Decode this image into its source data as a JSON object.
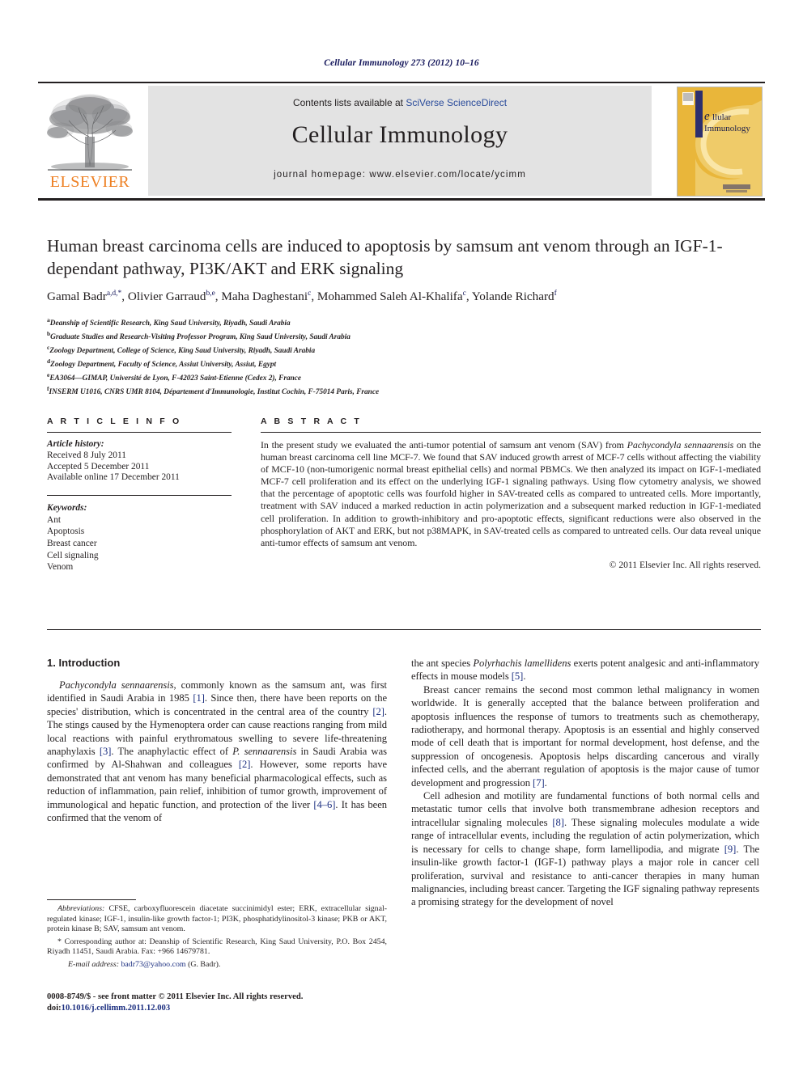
{
  "running_head": "Cellular Immunology 273 (2012) 10–16",
  "masthead": {
    "contents_prefix": "Contents lists available at ",
    "sciencedirect": "SciVerse ScienceDirect",
    "journal_title": "Cellular Immunology",
    "homepage": "journal homepage: www.elsevier.com/locate/ycimm",
    "publisher_wordmark": "ELSEVIER",
    "cover_title_line1": "ellular",
    "cover_title_line2": "Immunology"
  },
  "article": {
    "title": "Human breast carcinoma cells are induced to apoptosis by samsum ant venom through an IGF-1-dependant pathway, PI3K/AKT and ERK signaling",
    "authors": [
      {
        "name": "Gamal Badr",
        "sup": "a,d,*"
      },
      {
        "name": "Olivier Garraud",
        "sup": "b,e"
      },
      {
        "name": "Maha Daghestani",
        "sup": "c"
      },
      {
        "name": "Mohammed Saleh Al-Khalifa",
        "sup": "c"
      },
      {
        "name": "Yolande Richard",
        "sup": "f"
      }
    ],
    "affiliations": [
      {
        "label": "a",
        "text": "Deanship of Scientific Research, King Saud University, Riyadh, Saudi Arabia"
      },
      {
        "label": "b",
        "text": "Graduate Studies and Research-Visiting Professor Program, King Saud University, Saudi Arabia"
      },
      {
        "label": "c",
        "text": "Zoology Department, College of Science, King Saud University, Riyadh, Saudi Arabia"
      },
      {
        "label": "d",
        "text": "Zoology Department, Faculty of Science, Assiut University, Assiut, Egypt"
      },
      {
        "label": "e",
        "text": "EA3064—GIMAP, Université de Lyon, F-42023 Saint-Etienne (Cedex 2), France"
      },
      {
        "label": "f",
        "text": "INSERM U1016, CNRS UMR 8104, Département d'Immunologie, Institut Cochin, F-75014 Paris, France"
      }
    ]
  },
  "article_info": {
    "heading": "A R T I C L E   I N F O",
    "history_label": "Article history:",
    "history": [
      "Received 8 July 2011",
      "Accepted 5 December 2011",
      "Available online 17 December 2011"
    ],
    "keywords_label": "Keywords:",
    "keywords": [
      "Ant",
      "Apoptosis",
      "Breast cancer",
      "Cell signaling",
      "Venom"
    ]
  },
  "abstract": {
    "heading": "A B S T R A C T",
    "part1": "In the present study we evaluated the anti-tumor potential of samsum ant venom (SAV) from ",
    "italic1": "Pachycondyla sennaarensis",
    "part2": " on the human breast carcinoma cell line MCF-7. We found that SAV induced growth arrest of MCF-7 cells without affecting the viability of MCF-10 (non-tumorigenic normal breast epithelial cells) and normal PBMCs. We then analyzed its impact on IGF-1-mediated MCF-7 cell proliferation and its effect on the underlying IGF-1 signaling pathways. Using flow cytometry analysis, we showed that the percentage of apoptotic cells was fourfold higher in SAV-treated cells as compared to untreated cells. More importantly, treatment with SAV induced a marked reduction in actin polymerization and a subsequent marked reduction in IGF-1-mediated cell proliferation. In addition to growth-inhibitory and pro-apoptotic effects, significant reductions were also observed in the phosphorylation of AKT and ERK, but not p38MAPK, in SAV-treated cells as compared to untreated cells. Our data reveal unique anti-tumor effects of samsum ant venom.",
    "copyright": "© 2011 Elsevier Inc. All rights reserved."
  },
  "body": {
    "section_heading": "1. Introduction",
    "left_para1_a": "",
    "left_para1_italic": "Pachycondyla sennaarensis",
    "left_para1_b": ", commonly known as the samsum ant, was first identified in Saudi Arabia in 1985 ",
    "left_cite1": "[1]",
    "left_para1_c": ". Since then, there have been reports on the species' distribution, which is concentrated in the central area of the country ",
    "left_cite2": "[2]",
    "left_para1_d": ". The stings caused by the Hymenoptera order can cause reactions ranging from mild local reactions with painful erythromatous swelling to severe life-threatening anaphylaxis ",
    "left_cite3": "[3]",
    "left_para1_e": ". The anaphylactic effect of ",
    "left_para1_italic2": "P. sennaarensis",
    "left_para1_f": " in Saudi Arabia was confirmed by Al-Shahwan and colleagues ",
    "left_cite4": "[2]",
    "left_para1_g": ". However, some reports have demonstrated that ant venom has many beneficial pharmacological effects, such as reduction of inflammation, pain relief, inhibition of tumor growth, improvement of immunological and hepatic function, and protection of the liver ",
    "left_cite5": "[4–6]",
    "left_para1_h": ". It has been confirmed that the venom of",
    "right_para1_a": "the ant species ",
    "right_para1_italic": "Polyrhachis lamellidens",
    "right_para1_b": " exerts potent analgesic and anti-inflammatory effects in mouse models ",
    "right_cite1": "[5]",
    "right_para1_c": ".",
    "right_para2_a": "Breast cancer remains the second most common lethal malignancy in women worldwide. It is generally accepted that the balance between proliferation and apoptosis influences the response of tumors to treatments such as chemotherapy, radiotherapy, and hormonal therapy. Apoptosis is an essential and highly conserved mode of cell death that is important for normal development, host defense, and the suppression of oncogenesis. Apoptosis helps discarding cancerous and virally infected cells, and the aberrant regulation of apoptosis is the major cause of tumor development and progression ",
    "right_cite2": "[7]",
    "right_para2_b": ".",
    "right_para3_a": "Cell adhesion and motility are fundamental functions of both normal cells and metastatic tumor cells that involve both transmembrane adhesion receptors and intracellular signaling molecules ",
    "right_cite3": "[8]",
    "right_para3_b": ". These signaling molecules modulate a wide range of intracellular events, including the regulation of actin polymerization, which is necessary for cells to change shape, form lamellipodia, and migrate ",
    "right_cite4": "[9]",
    "right_para3_c": ". The insulin-like growth factor-1 (IGF-1) pathway plays a major role in cancer cell proliferation, survival and resistance to anti-cancer therapies in many human malignancies, including breast cancer. Targeting the IGF signaling pathway represents a promising strategy for the development of novel"
  },
  "footnotes": {
    "abbrev_label": "Abbreviations:",
    "abbrev_text": " CFSE, carboxyfluorescein diacetate succinimidyl ester; ERK, extracellular signal-regulated kinase; IGF-1, insulin-like growth factor-1; PI3K, phosphatidylinositol-3 kinase; PKB or AKT, protein kinase B; SAV, samsum ant venom.",
    "corresponding": "* Corresponding author at: Deanship of Scientific Research, King Saud University, P.O. Box 2454, Riyadh 11451, Saudi Arabia. Fax: +966 14679781.",
    "email_label": "E-mail address:",
    "email": "badr73@yahoo.com",
    "email_suffix": " (G. Badr)."
  },
  "imprint": {
    "issn_line": "0008-8749/$ - see front matter © 2011 Elsevier Inc. All rights reserved.",
    "doi_prefix": "doi:",
    "doi": "10.1016/j.cellimm.2011.12.003"
  },
  "colors": {
    "running_head": "#16185c",
    "link_blue": "#2b4c9b",
    "citation_blue": "#1c2f80",
    "elsevier_orange": "#ee8023",
    "masthead_grey": "#e3e3e3",
    "cover_gold": "#e9b63a",
    "cover_navy": "#2d2f6e"
  }
}
